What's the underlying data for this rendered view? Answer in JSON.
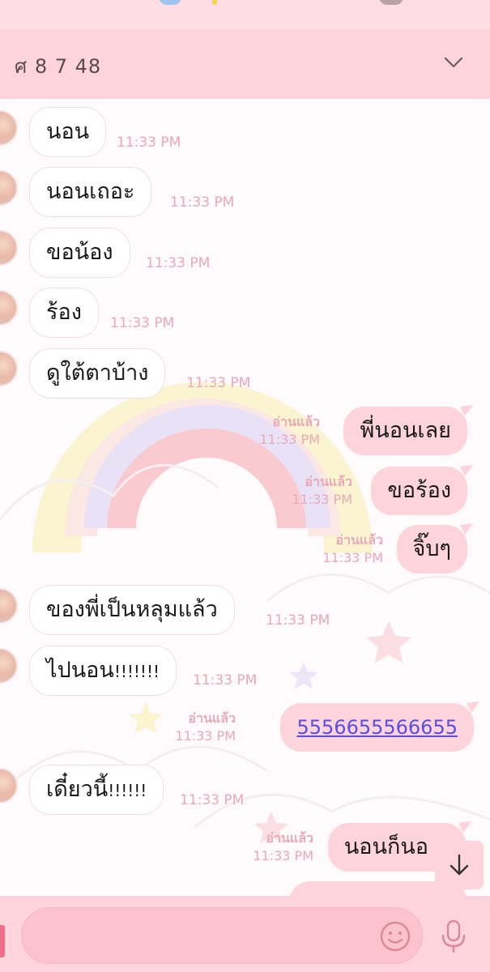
{
  "header": {
    "title": "ศ 8 7 48"
  },
  "colors": {
    "header": "#fdd4dc",
    "outgoing_bubble": "#fdd3dc",
    "incoming_bubble": "#ffffff",
    "timestamp": "#e8a9b8",
    "link": "#5a4de0"
  },
  "messages": [
    {
      "dir": "in",
      "text": "นอน",
      "time": "11:33 PM"
    },
    {
      "dir": "in",
      "text": "นอนเถอะ",
      "time": "11:33 PM"
    },
    {
      "dir": "in",
      "text": "ขอน้อง",
      "time": "11:33 PM"
    },
    {
      "dir": "in",
      "text": "ร้อง",
      "time": "11:33 PM"
    },
    {
      "dir": "in",
      "text": "ดูใต้ตาบ้าง",
      "time": "11:33 PM"
    },
    {
      "dir": "out",
      "text": "พี่นอนเลย",
      "read": "อ่านแล้ว",
      "time": "11:33 PM"
    },
    {
      "dir": "out",
      "text": "ขอร้อง",
      "read": "อ่านแล้ว",
      "time": "11:33 PM"
    },
    {
      "dir": "out",
      "text": "จิ๊บๆ",
      "read": "อ่านแล้ว",
      "time": "11:33 PM"
    },
    {
      "dir": "in",
      "text": "ของพี่เป็นหลุมแล้ว",
      "time": "11:33 PM"
    },
    {
      "dir": "in",
      "text": "ไปนอน",
      "suffix": "!!!!!!!",
      "time": "11:33 PM"
    },
    {
      "dir": "out",
      "text": "5556655566655",
      "read": "อ่านแล้ว",
      "time": "11:33 PM",
      "link": true
    },
    {
      "dir": "in",
      "text": "เดี๋ยวนี้",
      "suffix": "!!!!!!",
      "time": "11:33 PM"
    },
    {
      "dir": "out",
      "text": "นอนก็นอ",
      "read": "อ่านแล้ว",
      "time": "11:33 PM"
    }
  ],
  "icons": {
    "chevron": "chevron-down-icon",
    "scroll": "arrow-down-icon",
    "emoji": "smiley-icon",
    "mic": "microphone-icon"
  },
  "input": {
    "placeholder": "",
    "value": ""
  }
}
